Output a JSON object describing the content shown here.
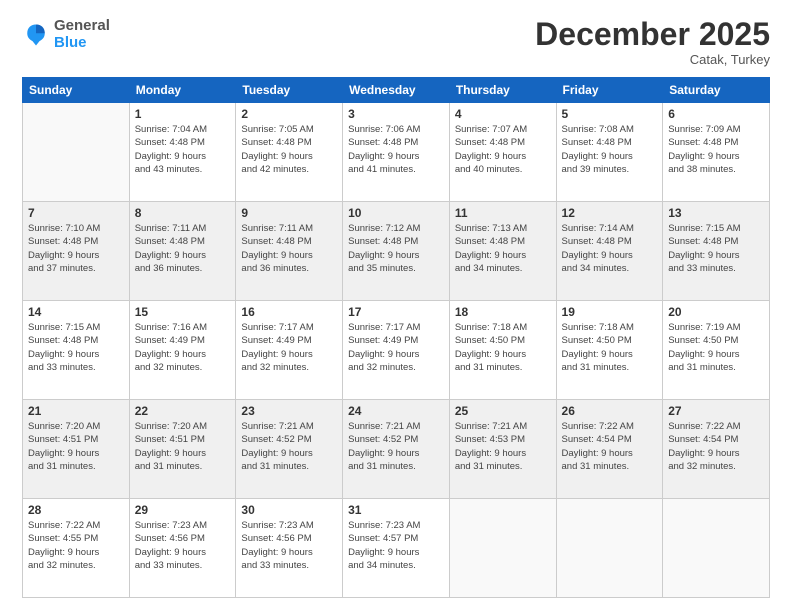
{
  "logo": {
    "general": "General",
    "blue": "Blue"
  },
  "header": {
    "month": "December 2025",
    "location": "Catak, Turkey"
  },
  "weekdays": [
    "Sunday",
    "Monday",
    "Tuesday",
    "Wednesday",
    "Thursday",
    "Friday",
    "Saturday"
  ],
  "weeks": [
    [
      {
        "day": "",
        "info": ""
      },
      {
        "day": "1",
        "info": "Sunrise: 7:04 AM\nSunset: 4:48 PM\nDaylight: 9 hours\nand 43 minutes."
      },
      {
        "day": "2",
        "info": "Sunrise: 7:05 AM\nSunset: 4:48 PM\nDaylight: 9 hours\nand 42 minutes."
      },
      {
        "day": "3",
        "info": "Sunrise: 7:06 AM\nSunset: 4:48 PM\nDaylight: 9 hours\nand 41 minutes."
      },
      {
        "day": "4",
        "info": "Sunrise: 7:07 AM\nSunset: 4:48 PM\nDaylight: 9 hours\nand 40 minutes."
      },
      {
        "day": "5",
        "info": "Sunrise: 7:08 AM\nSunset: 4:48 PM\nDaylight: 9 hours\nand 39 minutes."
      },
      {
        "day": "6",
        "info": "Sunrise: 7:09 AM\nSunset: 4:48 PM\nDaylight: 9 hours\nand 38 minutes."
      }
    ],
    [
      {
        "day": "7",
        "info": "Sunrise: 7:10 AM\nSunset: 4:48 PM\nDaylight: 9 hours\nand 37 minutes."
      },
      {
        "day": "8",
        "info": "Sunrise: 7:11 AM\nSunset: 4:48 PM\nDaylight: 9 hours\nand 36 minutes."
      },
      {
        "day": "9",
        "info": "Sunrise: 7:11 AM\nSunset: 4:48 PM\nDaylight: 9 hours\nand 36 minutes."
      },
      {
        "day": "10",
        "info": "Sunrise: 7:12 AM\nSunset: 4:48 PM\nDaylight: 9 hours\nand 35 minutes."
      },
      {
        "day": "11",
        "info": "Sunrise: 7:13 AM\nSunset: 4:48 PM\nDaylight: 9 hours\nand 34 minutes."
      },
      {
        "day": "12",
        "info": "Sunrise: 7:14 AM\nSunset: 4:48 PM\nDaylight: 9 hours\nand 34 minutes."
      },
      {
        "day": "13",
        "info": "Sunrise: 7:15 AM\nSunset: 4:48 PM\nDaylight: 9 hours\nand 33 minutes."
      }
    ],
    [
      {
        "day": "14",
        "info": "Sunrise: 7:15 AM\nSunset: 4:48 PM\nDaylight: 9 hours\nand 33 minutes."
      },
      {
        "day": "15",
        "info": "Sunrise: 7:16 AM\nSunset: 4:49 PM\nDaylight: 9 hours\nand 32 minutes."
      },
      {
        "day": "16",
        "info": "Sunrise: 7:17 AM\nSunset: 4:49 PM\nDaylight: 9 hours\nand 32 minutes."
      },
      {
        "day": "17",
        "info": "Sunrise: 7:17 AM\nSunset: 4:49 PM\nDaylight: 9 hours\nand 32 minutes."
      },
      {
        "day": "18",
        "info": "Sunrise: 7:18 AM\nSunset: 4:50 PM\nDaylight: 9 hours\nand 31 minutes."
      },
      {
        "day": "19",
        "info": "Sunrise: 7:18 AM\nSunset: 4:50 PM\nDaylight: 9 hours\nand 31 minutes."
      },
      {
        "day": "20",
        "info": "Sunrise: 7:19 AM\nSunset: 4:50 PM\nDaylight: 9 hours\nand 31 minutes."
      }
    ],
    [
      {
        "day": "21",
        "info": "Sunrise: 7:20 AM\nSunset: 4:51 PM\nDaylight: 9 hours\nand 31 minutes."
      },
      {
        "day": "22",
        "info": "Sunrise: 7:20 AM\nSunset: 4:51 PM\nDaylight: 9 hours\nand 31 minutes."
      },
      {
        "day": "23",
        "info": "Sunrise: 7:21 AM\nSunset: 4:52 PM\nDaylight: 9 hours\nand 31 minutes."
      },
      {
        "day": "24",
        "info": "Sunrise: 7:21 AM\nSunset: 4:52 PM\nDaylight: 9 hours\nand 31 minutes."
      },
      {
        "day": "25",
        "info": "Sunrise: 7:21 AM\nSunset: 4:53 PM\nDaylight: 9 hours\nand 31 minutes."
      },
      {
        "day": "26",
        "info": "Sunrise: 7:22 AM\nSunset: 4:54 PM\nDaylight: 9 hours\nand 31 minutes."
      },
      {
        "day": "27",
        "info": "Sunrise: 7:22 AM\nSunset: 4:54 PM\nDaylight: 9 hours\nand 32 minutes."
      }
    ],
    [
      {
        "day": "28",
        "info": "Sunrise: 7:22 AM\nSunset: 4:55 PM\nDaylight: 9 hours\nand 32 minutes."
      },
      {
        "day": "29",
        "info": "Sunrise: 7:23 AM\nSunset: 4:56 PM\nDaylight: 9 hours\nand 33 minutes."
      },
      {
        "day": "30",
        "info": "Sunrise: 7:23 AM\nSunset: 4:56 PM\nDaylight: 9 hours\nand 33 minutes."
      },
      {
        "day": "31",
        "info": "Sunrise: 7:23 AM\nSunset: 4:57 PM\nDaylight: 9 hours\nand 34 minutes."
      },
      {
        "day": "",
        "info": ""
      },
      {
        "day": "",
        "info": ""
      },
      {
        "day": "",
        "info": ""
      }
    ]
  ]
}
